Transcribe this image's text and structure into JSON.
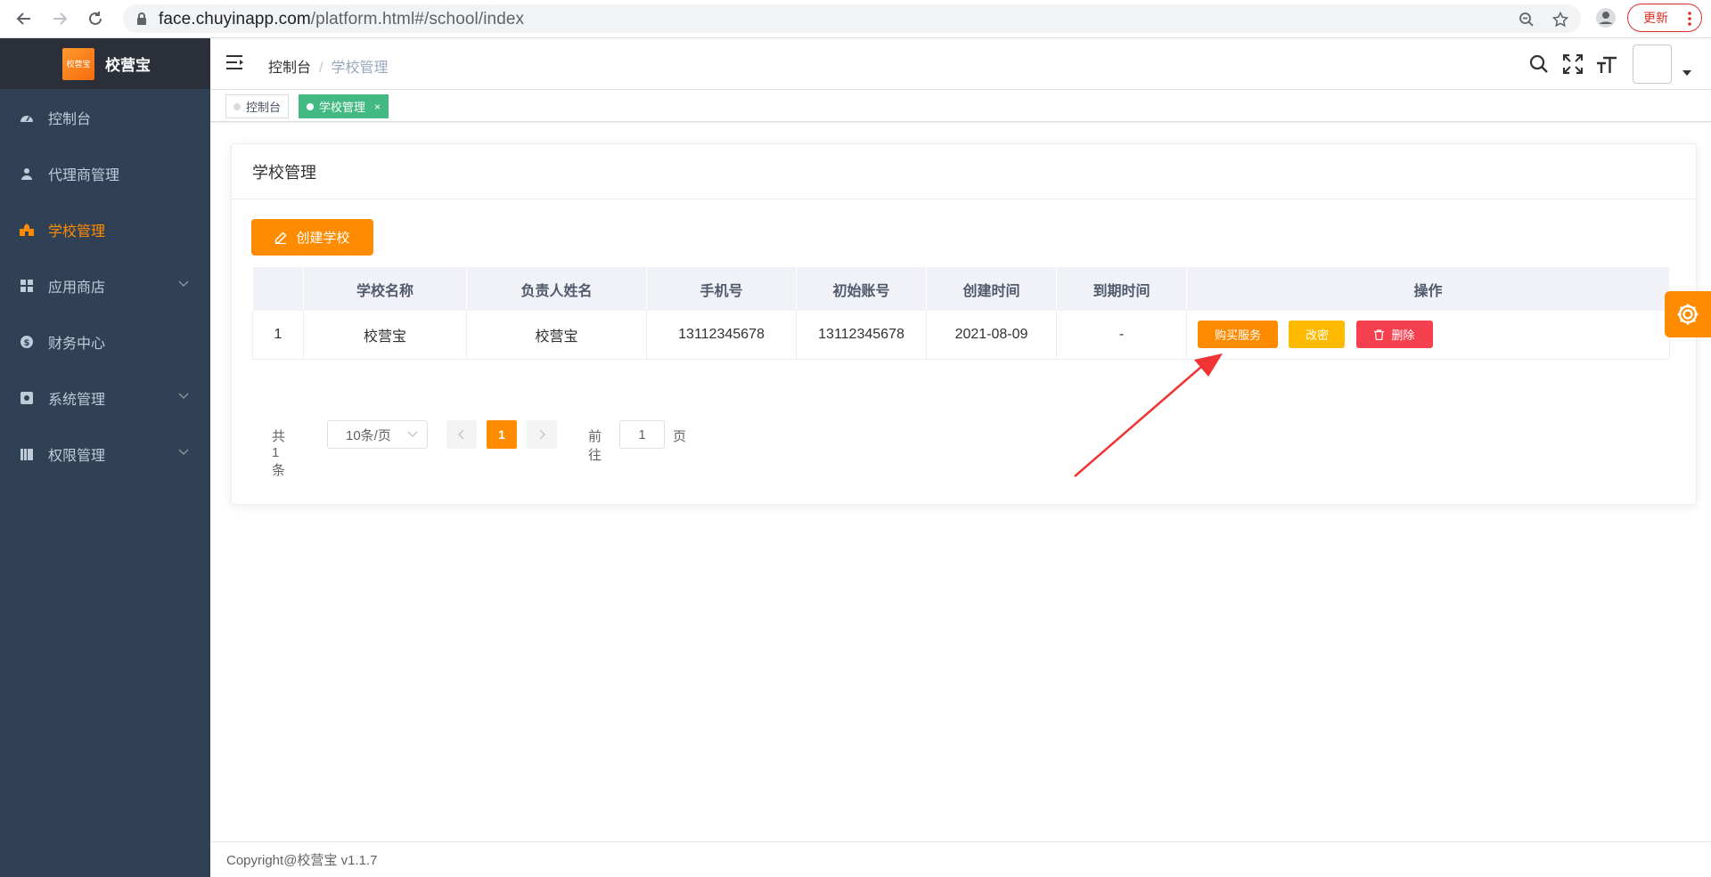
{
  "browser": {
    "url_host": "face.chuyinapp.com",
    "url_path": "/platform.html#/school/index",
    "update_label": "更新"
  },
  "sidebar": {
    "brand_logo_text": "校营宝",
    "brand_title": "校营宝",
    "items": [
      {
        "label": "控制台",
        "icon": "dashboard-icon",
        "active": false,
        "expandable": false
      },
      {
        "label": "代理商管理",
        "icon": "user-icon",
        "active": false,
        "expandable": false
      },
      {
        "label": "学校管理",
        "icon": "school-icon",
        "active": true,
        "expandable": false
      },
      {
        "label": "应用商店",
        "icon": "windows-icon",
        "active": false,
        "expandable": true
      },
      {
        "label": "财务中心",
        "icon": "money-icon",
        "active": false,
        "expandable": false
      },
      {
        "label": "系统管理",
        "icon": "system-icon",
        "active": false,
        "expandable": true
      },
      {
        "label": "权限管理",
        "icon": "permission-icon",
        "active": false,
        "expandable": true
      }
    ]
  },
  "header": {
    "breadcrumb_home": "控制台",
    "breadcrumb_sep": "/",
    "breadcrumb_current": "学校管理"
  },
  "tags": [
    {
      "label": "控制台",
      "active": false
    },
    {
      "label": "学校管理",
      "active": true,
      "close": "×"
    }
  ],
  "card": {
    "title": "学校管理",
    "create_label": "创建学校"
  },
  "table": {
    "columns": [
      "",
      "学校名称",
      "负责人姓名",
      "手机号",
      "初始账号",
      "创建时间",
      "到期时间",
      "操作"
    ],
    "rows": [
      {
        "index": "1",
        "school": "校营宝",
        "owner": "校营宝",
        "phone": "13112345678",
        "account": "13112345678",
        "created": "2021-08-09",
        "expires": "-",
        "actions": {
          "buy": "购买服务",
          "password": "改密",
          "delete": "删除"
        }
      }
    ]
  },
  "pager": {
    "total": "共 1 条",
    "page_size": "10条/页",
    "current": "1",
    "goto_label": "前往",
    "goto_value": "1",
    "page_label": "页"
  },
  "footer": {
    "copyright": "Copyright@校营宝 v1.1.7"
  },
  "colors": {
    "accent": "#ff8b00",
    "sidebar_bg": "#304156",
    "tag_active": "#42b983",
    "danger": "#f54050",
    "warning": "#ffba00",
    "arrow": "#f03434"
  }
}
